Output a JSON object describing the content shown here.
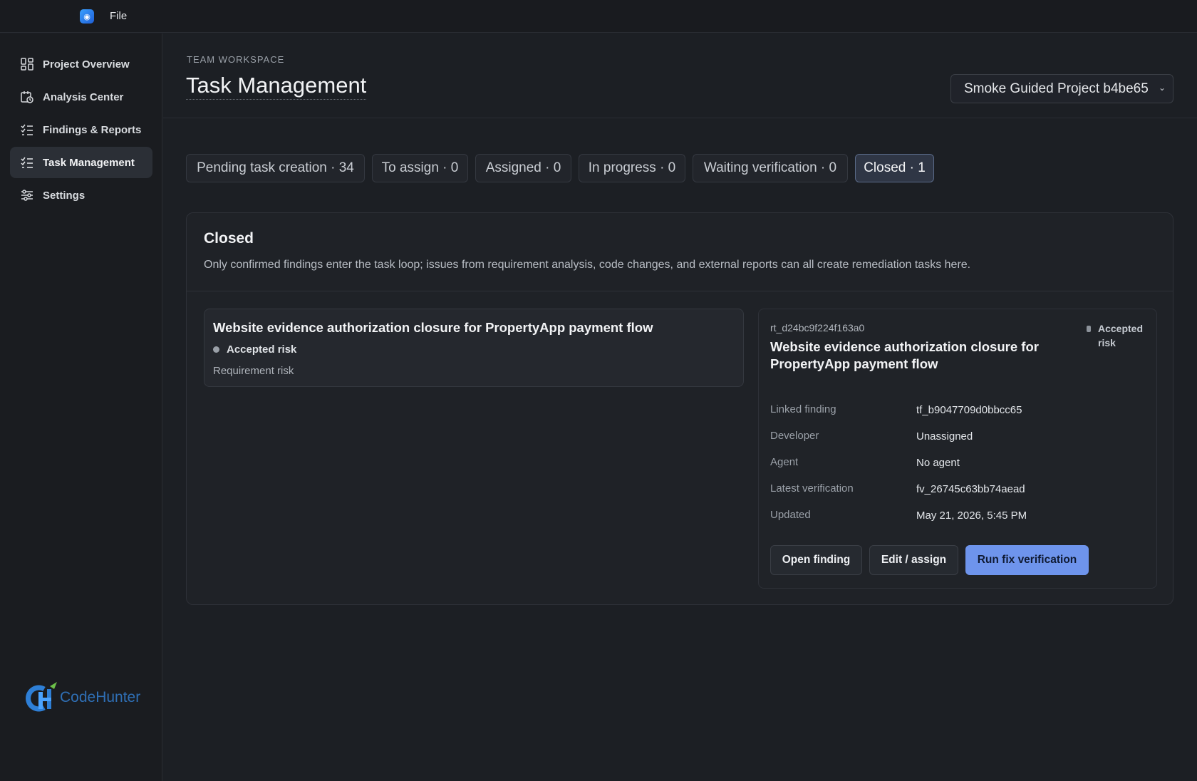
{
  "menubar": {
    "file_label": "File"
  },
  "sidebar": {
    "items": [
      {
        "label": "Project Overview",
        "icon": "dashboard-icon"
      },
      {
        "label": "Analysis Center",
        "icon": "calendar-clock-icon"
      },
      {
        "label": "Findings & Reports",
        "icon": "checklist-icon"
      },
      {
        "label": "Task Management",
        "icon": "checklist-icon",
        "active": true
      },
      {
        "label": "Settings",
        "icon": "sliders-icon"
      }
    ],
    "logo_text": "CodeHunter"
  },
  "header": {
    "eyebrow": "TEAM WORKSPACE",
    "title": "Task Management",
    "project_select": "Smoke Guided Project b4be65"
  },
  "tabs": [
    {
      "label": "Pending task creation · 34"
    },
    {
      "label": "To assign · 0"
    },
    {
      "label": "Assigned · 0"
    },
    {
      "label": "In progress · 0"
    },
    {
      "label": "Waiting verification · 0"
    },
    {
      "label": "Closed · 1",
      "active": true
    }
  ],
  "panel": {
    "title": "Closed",
    "description": "Only confirmed findings enter the task loop; issues from requirement analysis, code changes, and external reports can all create remediation tasks here."
  },
  "task_card": {
    "title": "Website evidence authorization closure for PropertyApp payment flow",
    "status": "Accepted risk",
    "type": "Requirement risk"
  },
  "detail": {
    "id": "rt_d24bc9f224f163a0",
    "title": "Website evidence authorization closure for PropertyApp payment flow",
    "badge_line1": "Accepted",
    "badge_line2": "risk",
    "fields": [
      {
        "label": "Linked finding",
        "value": "tf_b9047709d0bbcc65"
      },
      {
        "label": "Developer",
        "value": "Unassigned"
      },
      {
        "label": "Agent",
        "value": "No agent"
      },
      {
        "label": "Latest verification",
        "value": "fv_26745c63bb74aead"
      },
      {
        "label": "Updated",
        "value": "May 21, 2026, 5:45 PM"
      }
    ],
    "buttons": {
      "open_finding": "Open finding",
      "edit_assign": "Edit / assign",
      "run_fix_verification": "Run fix verification"
    }
  },
  "colors": {
    "background": "#1c1f24",
    "accent": "#6e94ec",
    "active_tab": "#2f3645"
  }
}
